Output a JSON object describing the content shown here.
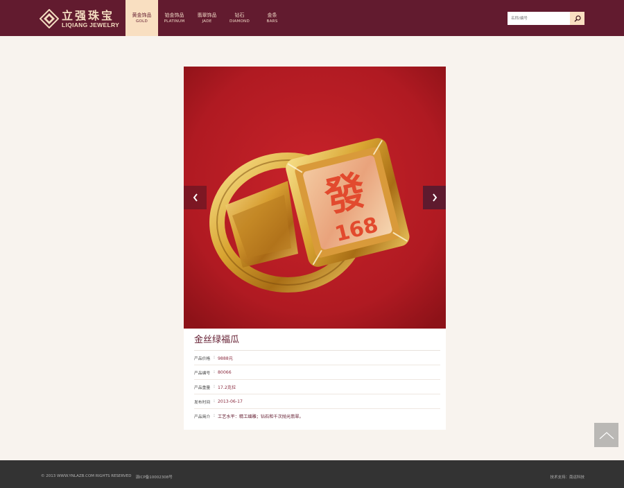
{
  "brand": {
    "name_cn": "立强珠宝",
    "name_en": "LIQIANG JEWELRY",
    "colors": {
      "header": "#621b2f",
      "accent": "#f9dfc1",
      "background": "#f8f3ee",
      "footer": "#333333"
    }
  },
  "nav": {
    "items": [
      {
        "cn": "黄金饰品",
        "en": "GOLD",
        "active": true
      },
      {
        "cn": "铂金饰品",
        "en": "PLATINUM",
        "active": false
      },
      {
        "cn": "翡翠饰品",
        "en": "JADE",
        "active": false
      },
      {
        "cn": "钻石",
        "en": "DIAMOND",
        "active": false
      },
      {
        "cn": "金条",
        "en": "BARS",
        "active": false
      }
    ]
  },
  "search": {
    "placeholder": "名称/编号",
    "icon": "search-icon"
  },
  "product": {
    "title": "金丝绿福瓜",
    "details": [
      {
        "label": "产品价格",
        "value": "9888元"
      },
      {
        "label": "产品编号",
        "value": "80066"
      },
      {
        "label": "产品重量",
        "value": "17.2克拉"
      },
      {
        "label": "发布时间",
        "value": "2013-06-17"
      },
      {
        "label": "产品简介",
        "value": "工艺水平：精工细雕；钻石和千次抛光翡翠。"
      }
    ],
    "image": {
      "icon": "gold-ring-image",
      "engraving": "發",
      "number": "168"
    }
  },
  "footer": {
    "copyright": "© 2013 WWW.YNLAZB.COM RIGHTS RESERVED",
    "icp": "滇ICP备10002308号",
    "support": "技术支持：南运科技"
  }
}
